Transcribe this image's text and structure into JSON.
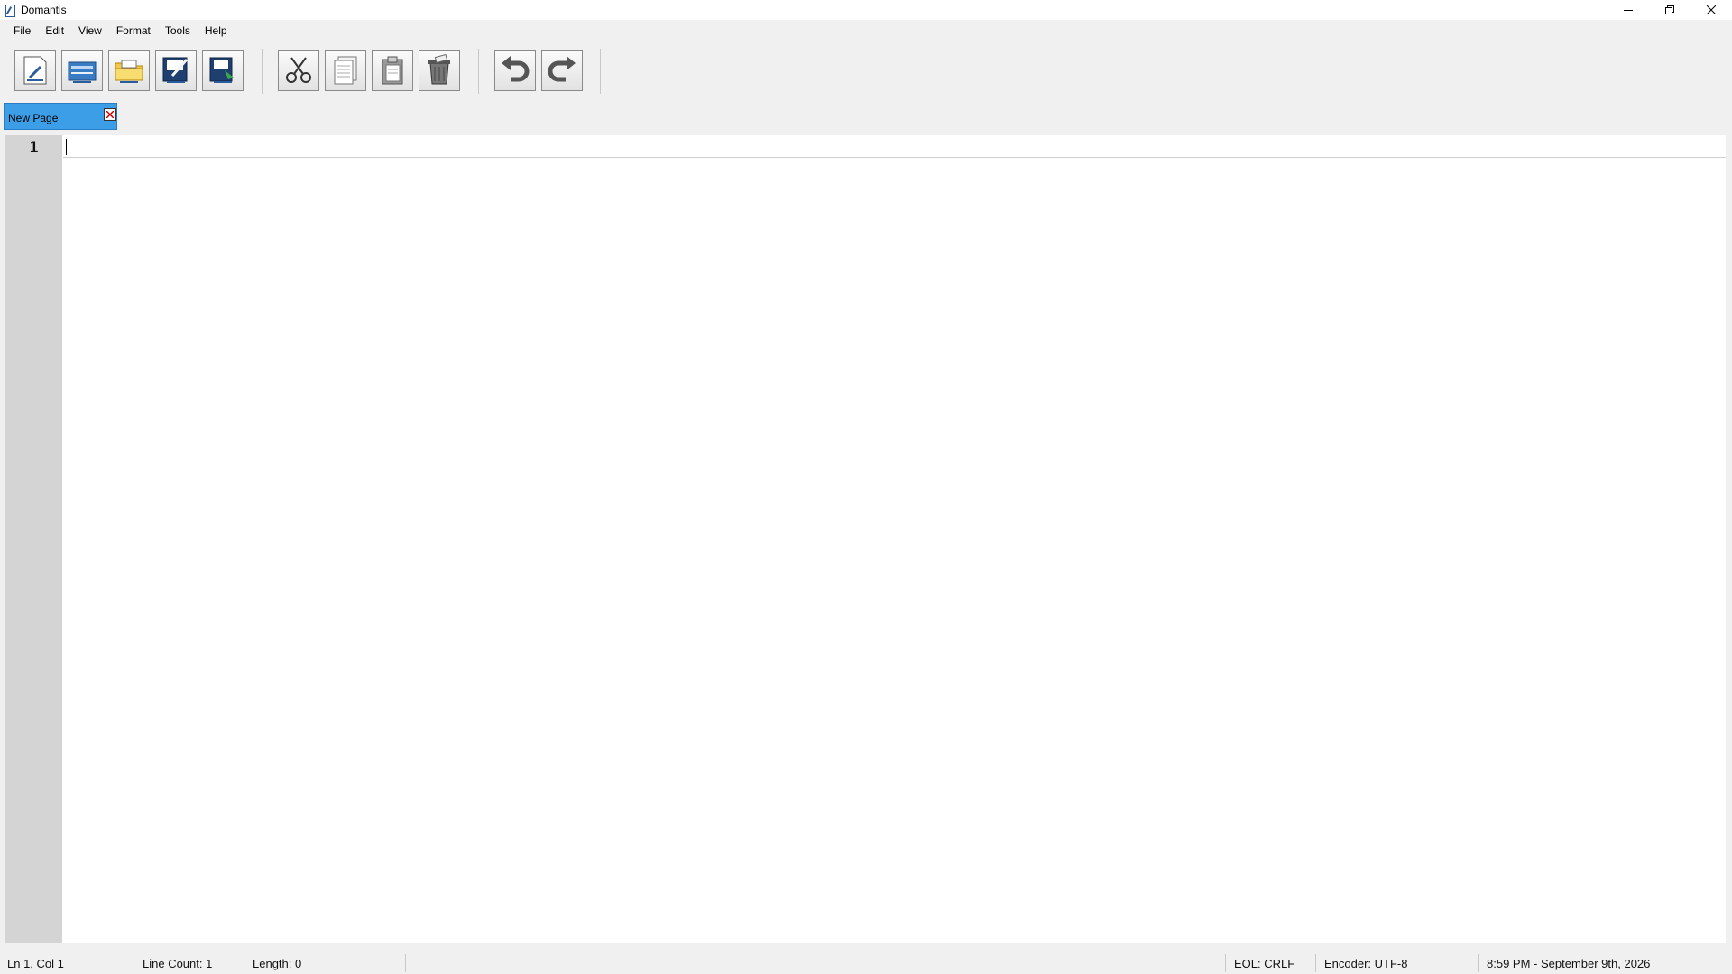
{
  "window": {
    "title": "Domantis",
    "controls": [
      "minimize-icon",
      "restore-icon",
      "close-icon"
    ]
  },
  "menu": {
    "items": [
      "File",
      "Edit",
      "View",
      "Format",
      "Tools",
      "Help"
    ]
  },
  "toolbar": {
    "groups": [
      [
        "new-file-icon",
        "open-file-icon",
        "open-folder-icon",
        "save-file-icon",
        "save-as-icon"
      ],
      [
        "cut-icon",
        "copy-icon",
        "paste-icon",
        "delete-icon"
      ],
      [
        "undo-icon",
        "redo-icon"
      ]
    ]
  },
  "tabs": {
    "active": {
      "label": "New Page"
    }
  },
  "editor": {
    "line_numbers": [
      "1"
    ],
    "content": ""
  },
  "status": {
    "position": "Ln 1, Col 1",
    "line_count": "Line Count: 1",
    "length": "Length: 0",
    "eol": "EOL: CRLF",
    "encoder": "Encoder: UTF-8",
    "datetime": "8:59 PM - September 9th, 2026"
  },
  "colors": {
    "active_tab": "#3d9ee8",
    "gutter": "#d4d4d4",
    "background": "#f0f0f0"
  }
}
